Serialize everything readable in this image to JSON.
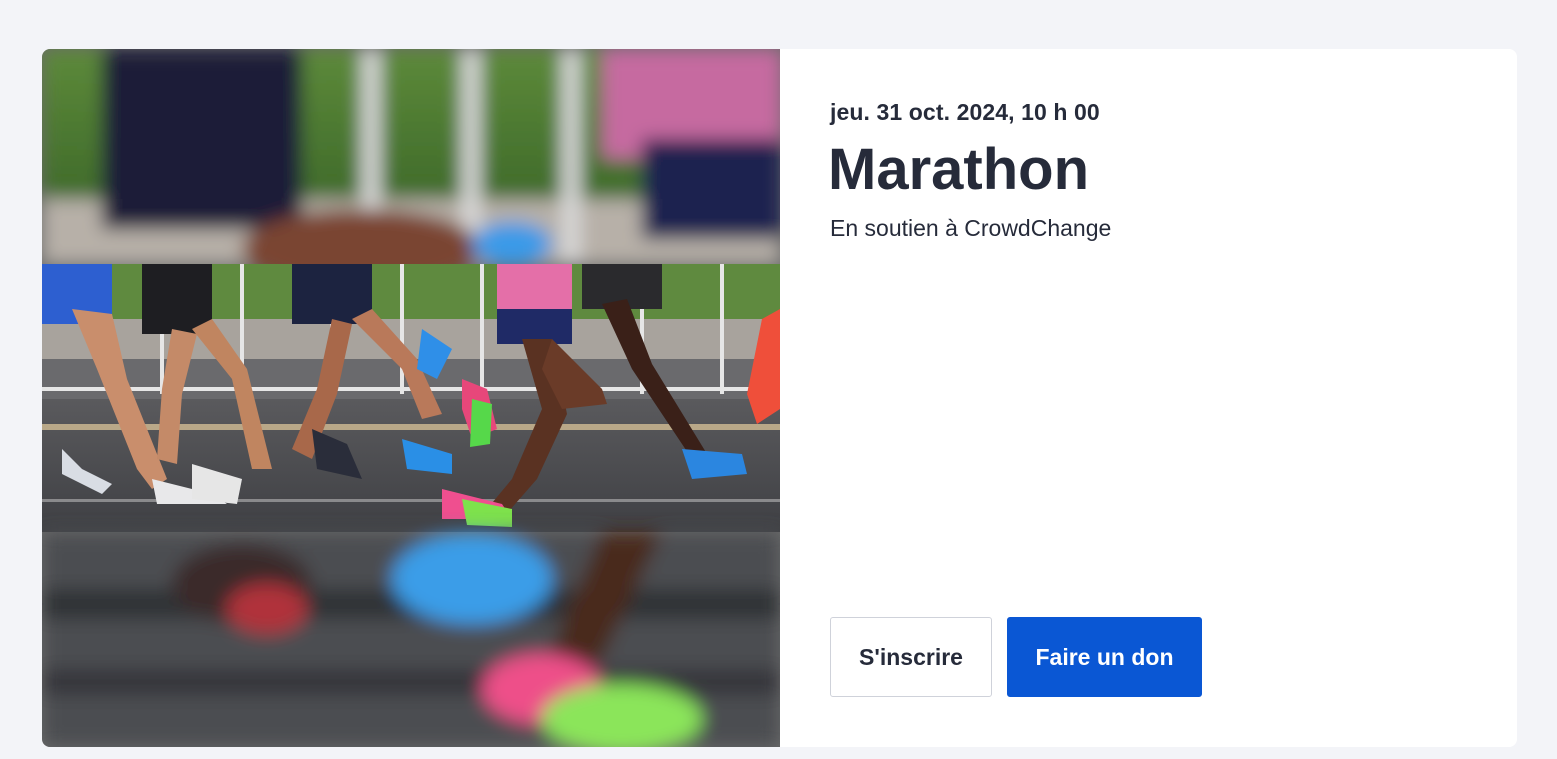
{
  "event": {
    "date": "jeu. 31 oct. 2024, 10 h 00",
    "title": "Marathon",
    "subtitle": "En soutien à CrowdChange"
  },
  "actions": {
    "register_label": "S'inscrire",
    "donate_label": "Faire un don"
  },
  "colors": {
    "page_background": "#f3f4f8",
    "card_background": "#ffffff",
    "text": "#262b3a",
    "primary": "#0a57d4"
  },
  "media": {
    "image_subject": "runners-legs-photo"
  }
}
